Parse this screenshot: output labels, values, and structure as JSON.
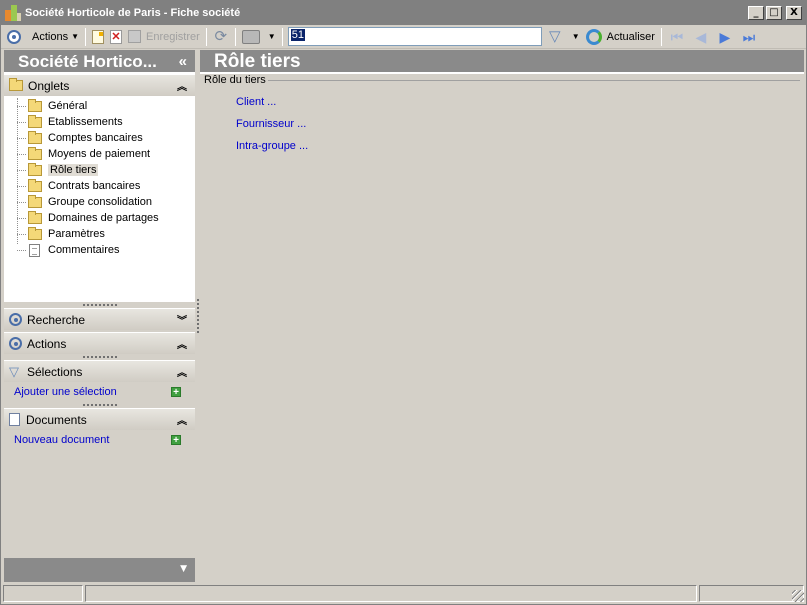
{
  "window": {
    "title": "Société Horticole de Paris - Fiche société",
    "controls": {
      "minimize": "_",
      "maximize": "□",
      "close": "X"
    }
  },
  "toolbar": {
    "actions_label": "Actions",
    "save_label": "Enregistrer",
    "search_value": "51",
    "refresh_label": "Actualiser"
  },
  "left_panel": {
    "header": "Société Hortico...",
    "collapse_glyph": "«",
    "tabs_section": {
      "title": "Onglets",
      "items": [
        {
          "label": "Général",
          "icon": "folder-icon"
        },
        {
          "label": "Etablissements",
          "icon": "folder-icon"
        },
        {
          "label": "Comptes bancaires",
          "icon": "folder-icon"
        },
        {
          "label": "Moyens de paiement",
          "icon": "folder-icon"
        },
        {
          "label": "Rôle tiers",
          "icon": "folder-open-icon",
          "selected": true
        },
        {
          "label": "Contrats bancaires",
          "icon": "folder-icon"
        },
        {
          "label": "Groupe consolidation",
          "icon": "folder-icon"
        },
        {
          "label": "Domaines de partages",
          "icon": "folder-icon"
        },
        {
          "label": "Paramètres",
          "icon": "folder-icon"
        },
        {
          "label": "Commentaires",
          "icon": "page-icon"
        }
      ]
    },
    "search_section": {
      "title": "Recherche"
    },
    "actions_section": {
      "title": "Actions"
    },
    "selections_section": {
      "title": "Sélections",
      "link": "Ajouter une sélection"
    },
    "documents_section": {
      "title": "Documents",
      "link": "Nouveau document"
    }
  },
  "main": {
    "title": "Rôle tiers",
    "group_title": "Rôle du tiers",
    "roles": [
      "Client ...",
      "Fournisseur ...",
      "Intra-groupe ..."
    ]
  },
  "colors": {
    "header_bg": "#8a8a8a",
    "link": "#0000cc",
    "window_bg": "#d4d0c8",
    "selection": "#0a246a"
  }
}
